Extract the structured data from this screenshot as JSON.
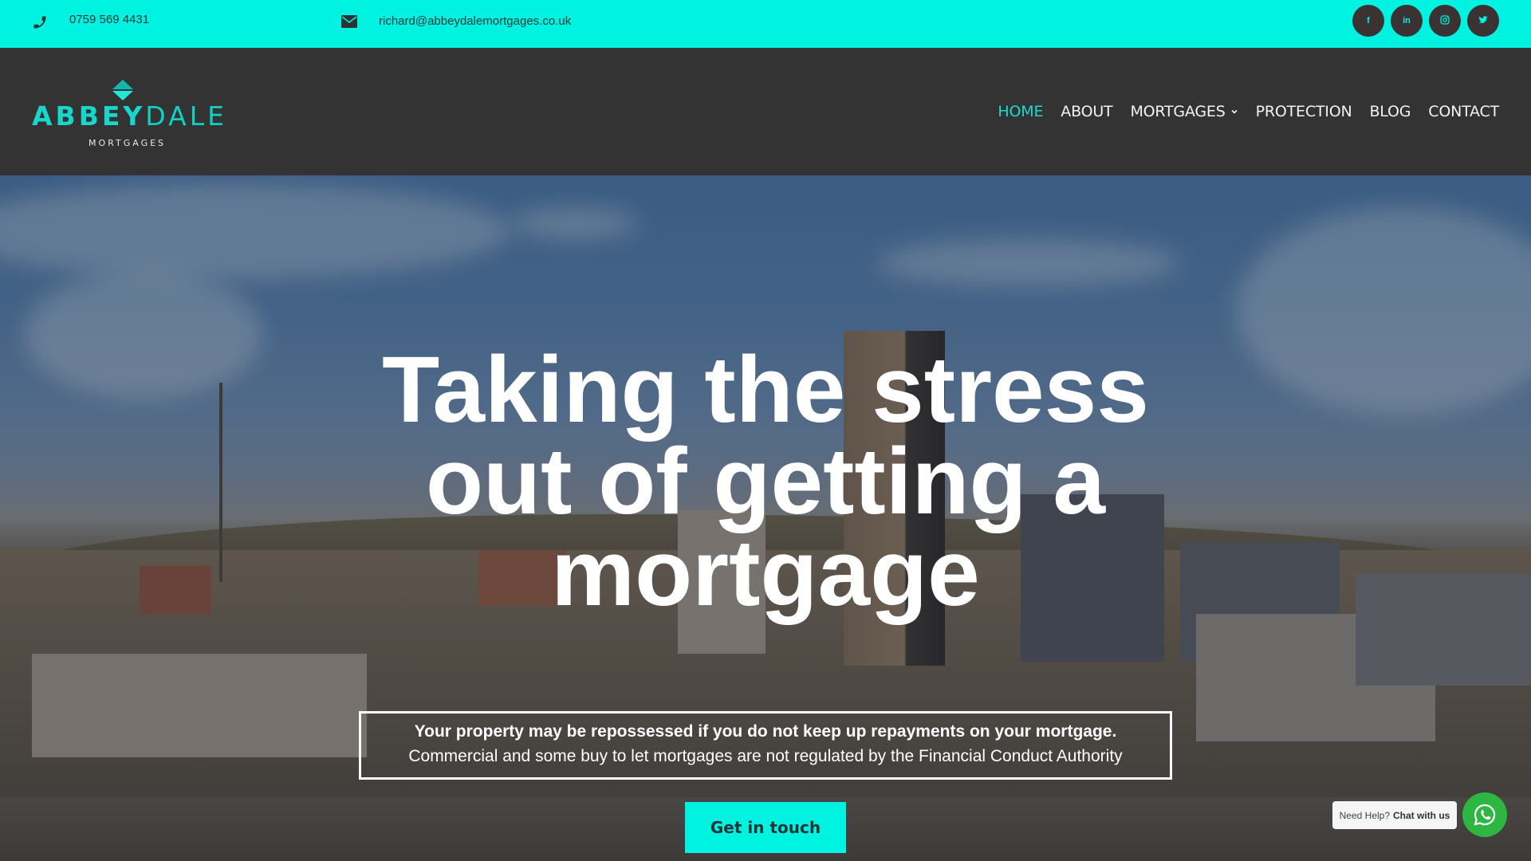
{
  "topbar": {
    "phone": "0759 569 4431",
    "email": "richard@abbeydalemortgages.co.uk",
    "socials": [
      {
        "name": "facebook",
        "icon": "facebook-icon",
        "glyph": "f"
      },
      {
        "name": "linkedin",
        "icon": "linkedin-icon",
        "glyph": "in"
      },
      {
        "name": "instagram",
        "icon": "instagram-icon",
        "glyph": ""
      },
      {
        "name": "twitter",
        "icon": "twitter-icon",
        "glyph": ""
      }
    ]
  },
  "header": {
    "logo": {
      "word_bold": "ABBEY",
      "word_light": "DALE",
      "sub": "MORTGAGES"
    },
    "nav": [
      {
        "label": "HOME",
        "active": true
      },
      {
        "label": "ABOUT",
        "active": false
      },
      {
        "label": "MORTGAGES",
        "active": false,
        "has_dropdown": true
      },
      {
        "label": "PROTECTION",
        "active": false
      },
      {
        "label": "BLOG",
        "active": false
      },
      {
        "label": "CONTACT",
        "active": false
      }
    ]
  },
  "hero": {
    "headline_lines": [
      "Taking the stress",
      "out of getting a",
      "mortgage"
    ],
    "disclaimer_bold": "Your property may be repossessed if you do not keep up repayments on your mortgage.",
    "disclaimer_regular": "Commercial and some buy to let mortgages are not regulated by the Financial Conduct Authority",
    "cta_label": "Get in touch"
  },
  "chat": {
    "prefix": "Need Help?",
    "bold": "Chat with us"
  },
  "colors": {
    "accent": "#00f2e0",
    "header_bg": "#333333",
    "nav_active": "#1fd9ce",
    "whatsapp": "#2db742"
  }
}
